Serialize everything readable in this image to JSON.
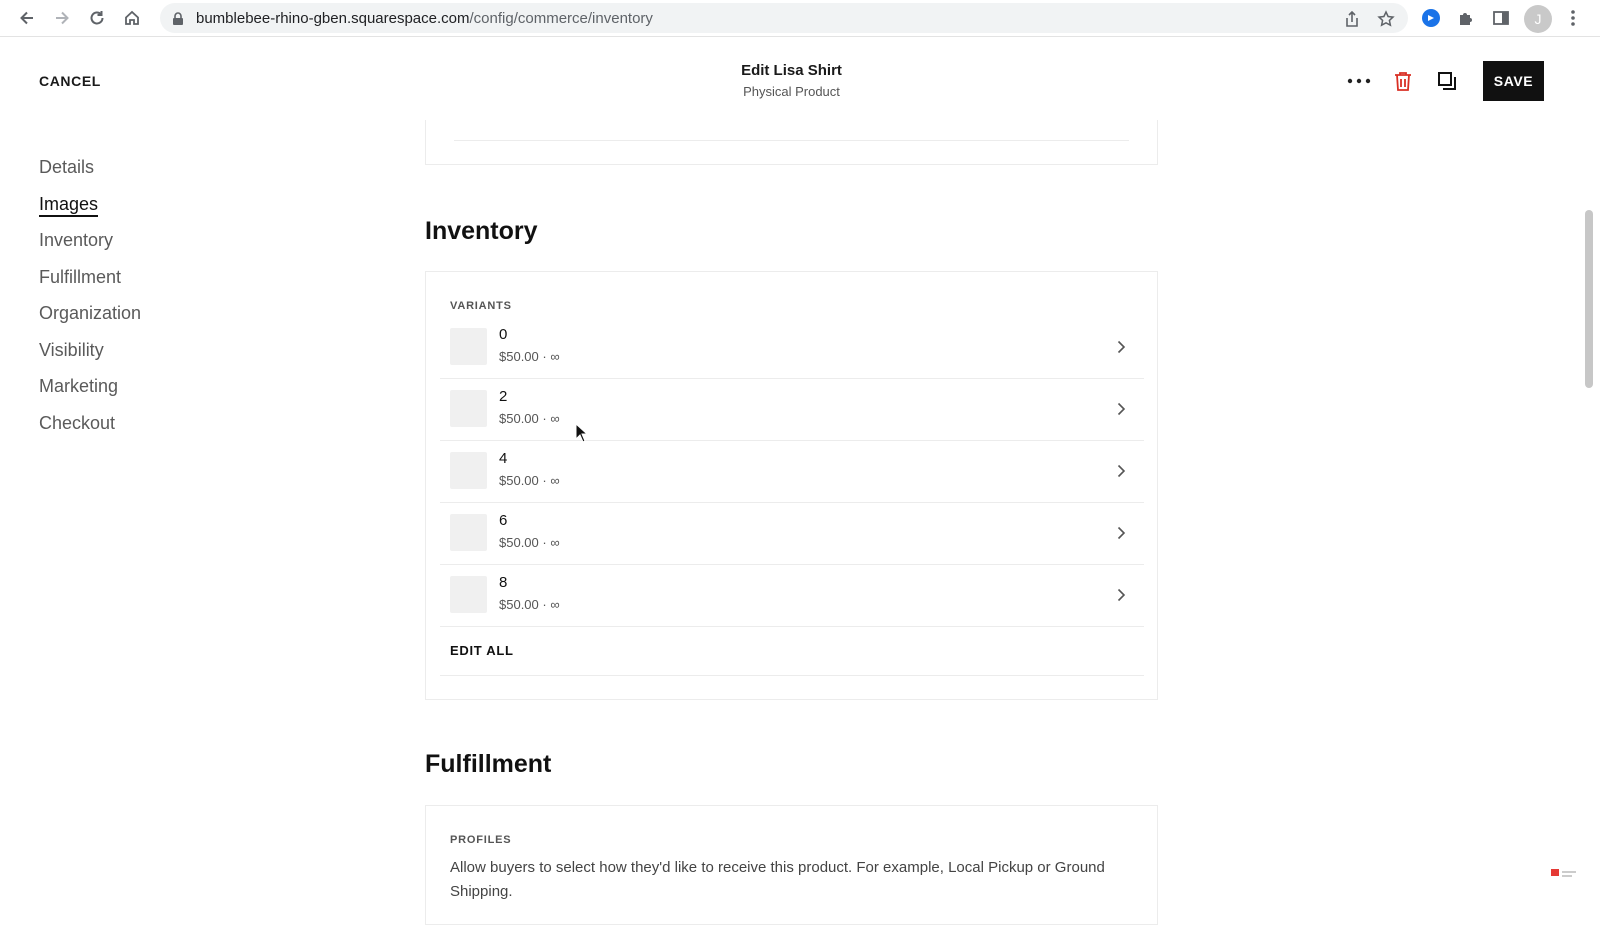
{
  "browser": {
    "url_host": "bumblebee-rhino-gben.squarespace.com",
    "url_path": "/config/commerce/inventory",
    "profile_initial": "J",
    "icons": [
      "back-icon",
      "forward-icon",
      "reload-icon",
      "home-icon",
      "lock-icon",
      "share-icon",
      "star-icon",
      "extension-icon",
      "puzzle-icon",
      "sidepanel-icon",
      "kebab-menu-icon"
    ]
  },
  "header": {
    "cancel_label": "CANCEL",
    "title": "Edit Lisa Shirt",
    "subtitle": "Physical Product",
    "save_label": "SAVE",
    "delete_color": "#d93025"
  },
  "sidebar": {
    "items": [
      {
        "label": "Details",
        "active": false
      },
      {
        "label": "Images",
        "active": true
      },
      {
        "label": "Inventory",
        "active": false
      },
      {
        "label": "Fulfillment",
        "active": false
      },
      {
        "label": "Organization",
        "active": false
      },
      {
        "label": "Visibility",
        "active": false
      },
      {
        "label": "Marketing",
        "active": false
      },
      {
        "label": "Checkout",
        "active": false
      }
    ]
  },
  "inventory": {
    "heading": "Inventory",
    "variants_label": "VARIANTS",
    "variants": [
      {
        "name": "0",
        "meta": "$50.00 · ∞"
      },
      {
        "name": "2",
        "meta": "$50.00 · ∞"
      },
      {
        "name": "4",
        "meta": "$50.00 · ∞"
      },
      {
        "name": "6",
        "meta": "$50.00 · ∞"
      },
      {
        "name": "8",
        "meta": "$50.00 · ∞"
      }
    ],
    "edit_all_label": "EDIT ALL"
  },
  "fulfillment": {
    "heading": "Fulfillment",
    "profiles_label": "PROFILES",
    "description": "Allow buyers to select how they'd like to receive this product. For example, Local Pickup or Ground Shipping."
  }
}
